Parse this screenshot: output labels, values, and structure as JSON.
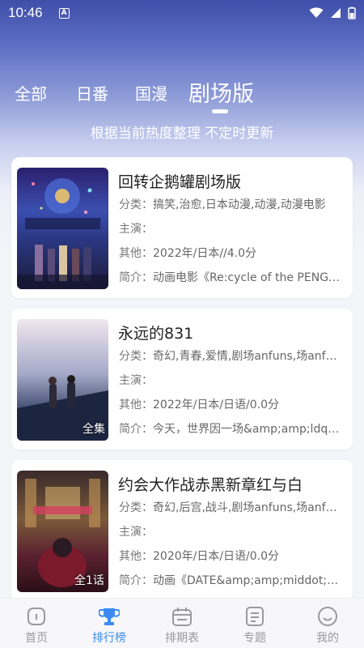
{
  "status": {
    "time": "10:46",
    "a_badge": "A"
  },
  "tabs": [
    {
      "label": "全部",
      "active": false
    },
    {
      "label": "日番",
      "active": false
    },
    {
      "label": "国漫",
      "active": false
    },
    {
      "label": "剧场版",
      "active": true
    }
  ],
  "subtitle": "根据当前热度整理 不定时更新",
  "labels": {
    "category": "分类：",
    "cast": "主演：",
    "other": "其他：",
    "intro": "简介："
  },
  "items": [
    {
      "title": "回转企鹅罐剧场版",
      "category": "搞笑,治愈,日本动漫,动漫,动漫电影",
      "cast": "",
      "other": "2022年/日本//4.0分",
      "intro": "动画电影《Re:cycle of the PENGUINDRUM》",
      "badge": ""
    },
    {
      "title": "永远的831",
      "category": "奇幻,青春,爱情,剧场anfuns,场anfuns",
      "cast": "",
      "other": "2022年/日本/日语/0.0分",
      "intro": "今天，世界因一场&amp;amp;ldquo;",
      "badge": "全集"
    },
    {
      "title": "约会大作战赤黑新章红与白",
      "category": "奇幻,后宫,战斗,剧场anfuns,场anfuns",
      "cast": "",
      "other": "2020年/日本/日语/0.0分",
      "intro": "动画《DATE&amp;amp;middot;A LIVE》",
      "badge": "全1话"
    }
  ],
  "nav": [
    {
      "label": "首页",
      "active": false,
      "icon": "home-icon"
    },
    {
      "label": "排行榜",
      "active": true,
      "icon": "trophy-icon"
    },
    {
      "label": "排期表",
      "active": false,
      "icon": "calendar-icon"
    },
    {
      "label": "专题",
      "active": false,
      "icon": "topic-icon"
    },
    {
      "label": "我的",
      "active": false,
      "icon": "profile-icon"
    }
  ],
  "colors": {
    "accent": "#3d8bf2",
    "inactive": "#9a9a9a",
    "header_top": "#3f4ea8"
  }
}
